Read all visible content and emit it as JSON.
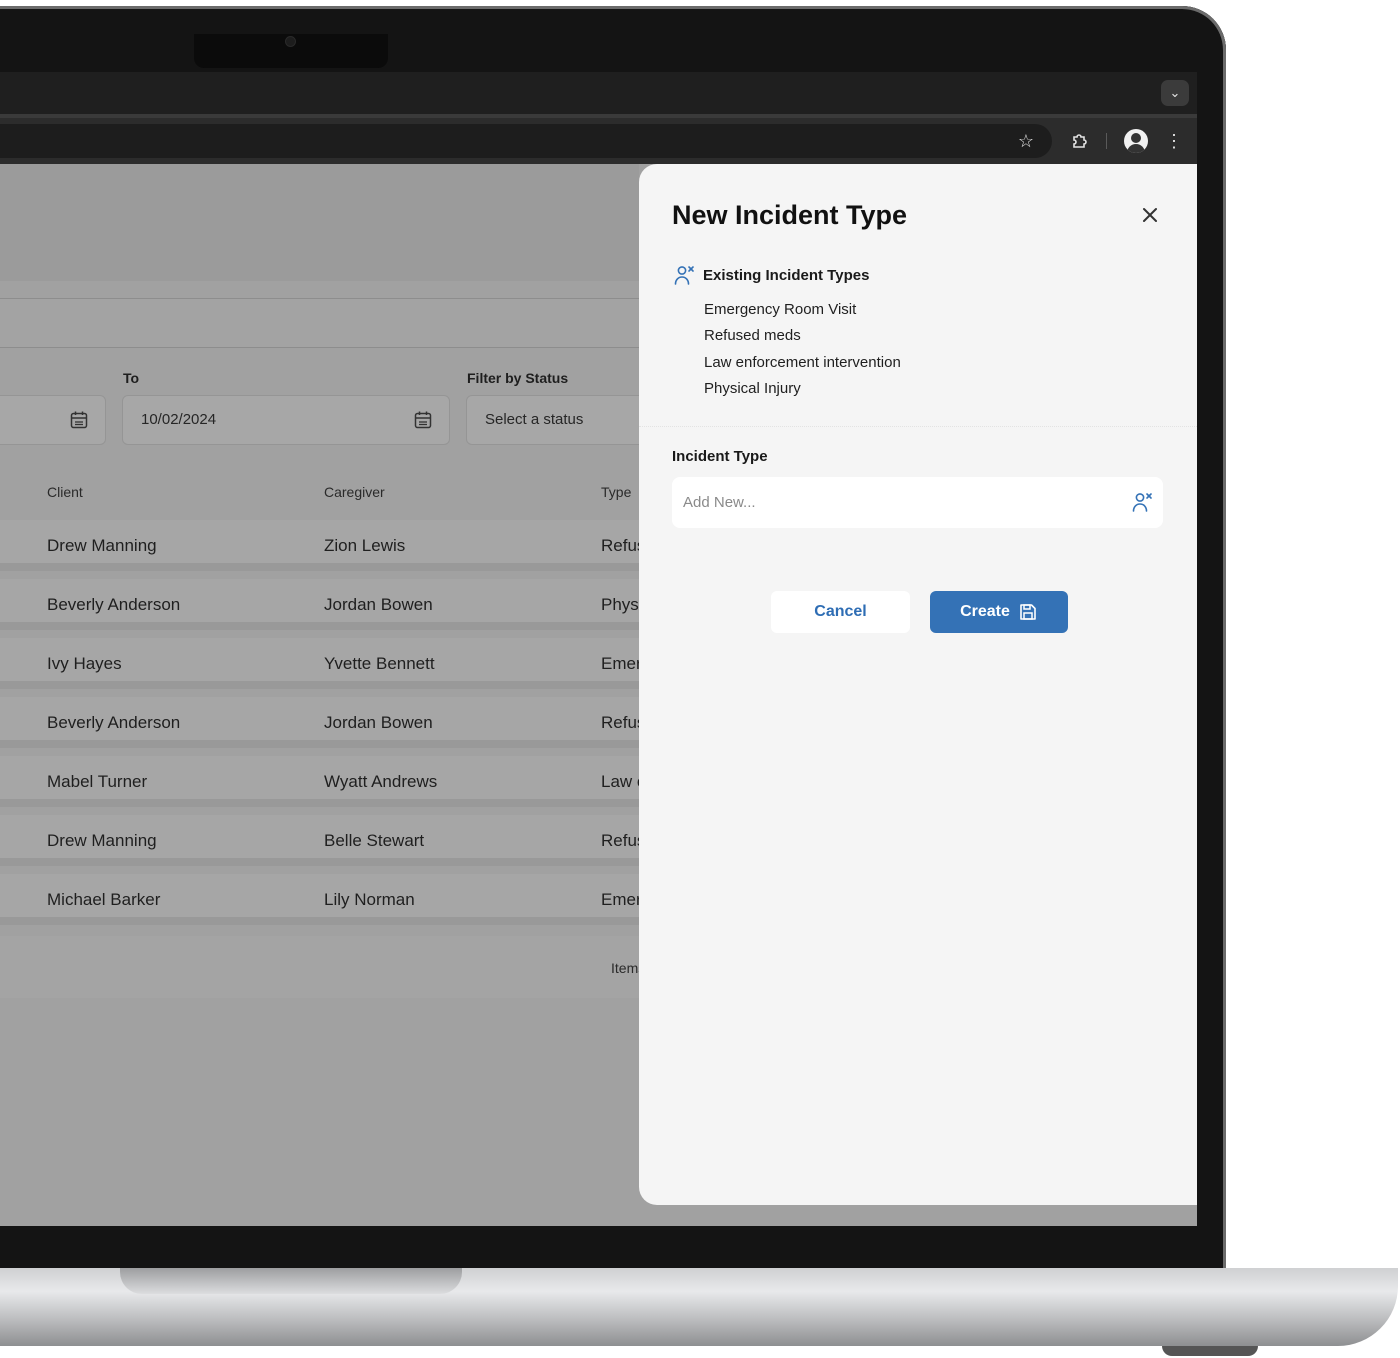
{
  "filters": {
    "to_label": "To",
    "to_value": "10/02/2024",
    "status_label": "Filter by Status",
    "status_placeholder": "Select a status"
  },
  "table": {
    "columns": [
      "Client",
      "Caregiver",
      "Type"
    ],
    "rows": [
      {
        "client": "Drew Manning",
        "caregiver": "Zion Lewis",
        "type": "Refus"
      },
      {
        "client": "Beverly Anderson",
        "caregiver": "Jordan Bowen",
        "type": "Phys"
      },
      {
        "client": "Ivy Hayes",
        "caregiver": "Yvette Bennett",
        "type": "Emer"
      },
      {
        "client": "Beverly Anderson",
        "caregiver": "Jordan Bowen",
        "type": "Refus"
      },
      {
        "client": "Mabel Turner",
        "caregiver": "Wyatt Andrews",
        "type": "Law e"
      },
      {
        "client": "Drew Manning",
        "caregiver": "Belle Stewart",
        "type": "Refus"
      },
      {
        "client": "Michael Barker",
        "caregiver": "Lily Norman",
        "type": "Emer"
      }
    ],
    "footer_text": "Items"
  },
  "drawer": {
    "title": "New Incident Type",
    "existing_title": "Existing Incident Types",
    "existing_items": [
      "Emergency Room Visit",
      "Refused meds",
      "Law enforcement intervention",
      "Physical Injury"
    ],
    "field_label": "Incident Type",
    "field_placeholder": "Add New...",
    "cancel_label": "Cancel",
    "create_label": "Create"
  },
  "colors": {
    "accent": "#3472b6",
    "drawer_bg": "#f5f5f5",
    "overlay": "#a1a1a1"
  },
  "icons": {
    "close": "close-icon",
    "incident_type": "user-x-icon",
    "save": "save-icon",
    "calendar": "calendar-icon",
    "star": "star-icon",
    "extensions": "puzzle-icon",
    "menu": "more-vertical-icon"
  }
}
